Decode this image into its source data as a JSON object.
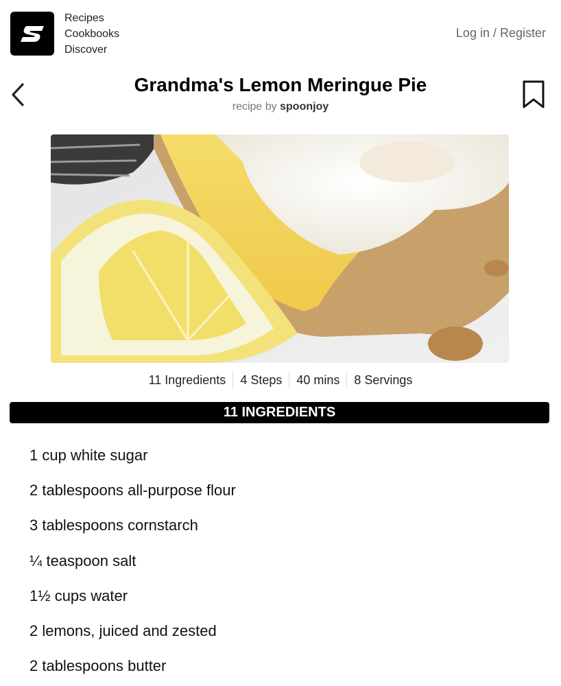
{
  "header": {
    "nav": [
      "Recipes",
      "Cookbooks",
      "Discover"
    ],
    "login_label": "Log in / Register"
  },
  "recipe": {
    "title": "Grandma's Lemon Meringue Pie",
    "byline_prefix": "recipe by",
    "author": "spoonjoy"
  },
  "stats": [
    "11 Ingredients",
    "4 Steps",
    "40 mins",
    "8 Servings"
  ],
  "ingredients_header": "11 INGREDIENTS",
  "ingredients": [
    "1 cup white sugar",
    "2 tablespoons all-purpose flour",
    "3 tablespoons cornstarch",
    "¼ teaspoon salt",
    "1½ cups water",
    "2 lemons, juiced and zested",
    "2 tablespoons butter"
  ]
}
